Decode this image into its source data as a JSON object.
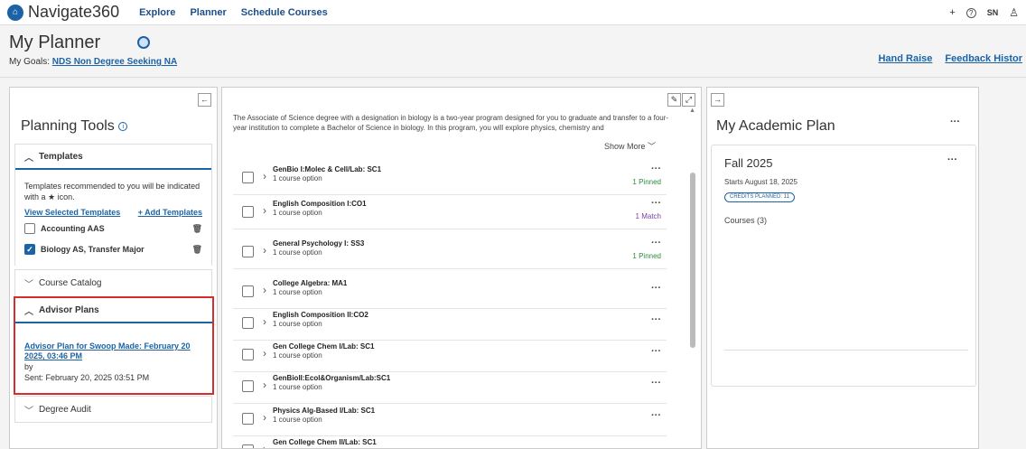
{
  "topnav": {
    "brand": "Navigate360",
    "links": [
      "Explore",
      "Planner",
      "Schedule Courses"
    ],
    "plus": "+",
    "help": "?",
    "avatar": "SN"
  },
  "header": {
    "title": "My Planner",
    "goals_label": "My Goals:",
    "goals_value": "NDS Non Degree Seeking NA",
    "hand_raise": "Hand Raise",
    "feedback": "Feedback Histor"
  },
  "tools": {
    "collapse": "←",
    "title": "Planning Tools",
    "templates": {
      "label": "Templates",
      "text": "Templates recommended to you will be indicated with a ★ icon.",
      "view": "View Selected Templates",
      "add": "+ Add Templates",
      "items": [
        {
          "name": "Accounting AAS",
          "checked": false
        },
        {
          "name": "Biology AS, Transfer Major",
          "checked": true
        }
      ]
    },
    "catalog": "Course Catalog",
    "advisor": {
      "label": "Advisor Plans",
      "link": "Advisor Plan for Swoop Made: February 20 2025, 03:46 PM",
      "by": "by",
      "sent": "Sent: February 20, 2025 03:51 PM"
    },
    "audit": "Degree Audit"
  },
  "mid": {
    "desc": "The Associate of Science degree with a designation in biology is a two-year program designed for you to graduate and transfer to a four-year institution to complete a Bachelor of Science in biology. In this program, you will explore physics, chemistry and",
    "show_more": "Show More",
    "courses": [
      {
        "name": "GenBio I:Molec & Cell/Lab: SC1",
        "opt": "1 course option",
        "status": "1 Pinned",
        "stype": "green"
      },
      {
        "name": "English Composition I:CO1",
        "opt": "1 course option",
        "status": "1 Match",
        "stype": "purple"
      },
      {
        "name": "General Psychology I: SS3",
        "opt": "1 course option",
        "status": "1 Pinned",
        "stype": "green"
      },
      {
        "name": "College Algebra: MA1",
        "opt": "1 course option",
        "status": "",
        "stype": ""
      },
      {
        "name": "English Composition II:CO2",
        "opt": "1 course option",
        "status": "",
        "stype": ""
      },
      {
        "name": "Gen College Chem I/Lab: SC1",
        "opt": "1 course option",
        "status": "",
        "stype": ""
      },
      {
        "name": "GenBioII:Ecol&Organism/Lab:SC1",
        "opt": "1 course option",
        "status": "",
        "stype": ""
      },
      {
        "name": "Physics Alg-Based I/Lab: SC1",
        "opt": "1 course option",
        "status": "",
        "stype": ""
      },
      {
        "name": "Gen College Chem II/Lab: SC1",
        "opt": "",
        "status": "",
        "stype": ""
      }
    ]
  },
  "plan": {
    "expand": "→",
    "title": "My Academic Plan",
    "term": "Fall 2025",
    "starts": "Starts August 18, 2025",
    "credits": "CREDITS PLANNED: 11",
    "courses": "Courses (3)"
  }
}
